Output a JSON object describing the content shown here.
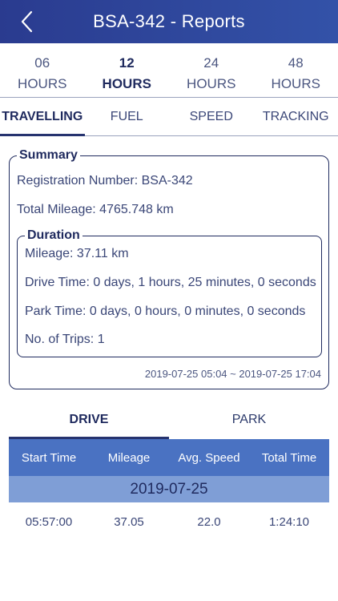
{
  "header": {
    "title": "BSA-342 - Reports",
    "back_icon": "chevron-left-icon"
  },
  "hours": [
    {
      "number": "06",
      "unit": "HOURS",
      "active": false
    },
    {
      "number": "12",
      "unit": "HOURS",
      "active": true
    },
    {
      "number": "24",
      "unit": "HOURS",
      "active": false
    },
    {
      "number": "48",
      "unit": "HOURS",
      "active": false
    }
  ],
  "tabs": [
    {
      "label": "TRAVELLING",
      "active": true
    },
    {
      "label": "FUEL",
      "active": false
    },
    {
      "label": "SPEED",
      "active": false
    },
    {
      "label": "TRACKING",
      "active": false
    }
  ],
  "summary": {
    "legend": "Summary",
    "registration": "Registration Number: BSA-342",
    "total_mileage": "Total Mileage: 4765.748 km",
    "duration": {
      "legend": "Duration",
      "mileage": "Mileage: 37.11 km",
      "drive_time": "Drive Time: 0 days, 1 hours, 25 minutes, 0 seconds",
      "park_time": "Park Time: 0 days, 0 hours, 0 minutes, 0 seconds",
      "trips": "No. of Trips: 1"
    },
    "date_range": "2019-07-25 05:04 ~ 2019-07-25 17:04"
  },
  "drive_tabs": [
    {
      "label": "DRIVE",
      "active": true
    },
    {
      "label": "PARK",
      "active": false
    }
  ],
  "table": {
    "columns": [
      "Start Time",
      "Mileage",
      "Avg. Speed",
      "Total Time"
    ],
    "group_date": "2019-07-25",
    "rows": [
      [
        "05:57:00",
        "37.05",
        "22.0",
        "1:24:10"
      ]
    ]
  },
  "colors": {
    "header_start": "#2a3b8f",
    "header_end": "#3352a8",
    "table_header": "#4a72c2",
    "date_row": "#7f9ed6",
    "accent_dark": "#1f2a5e"
  }
}
